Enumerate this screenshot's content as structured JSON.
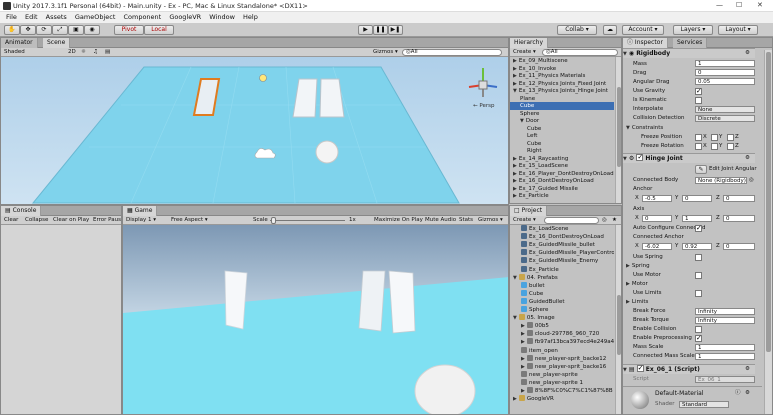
{
  "window": {
    "title": "Unity 2017.3.1f1 Personal (64bit) - Main.unity - Ex - PC, Mac & Linux Standalone* <DX11>",
    "min": "—",
    "max": "☐",
    "close": "✕"
  },
  "menu": [
    "File",
    "Edit",
    "Assets",
    "GameObject",
    "Component",
    "GoogleVR",
    "Window",
    "Help"
  ],
  "toolbar": {
    "pivot": "Pivot",
    "local": "Local",
    "collab": "Collab ▾",
    "account": "Account ▾",
    "layers": "Layers ▾",
    "layout": "Layout ▾"
  },
  "scene": {
    "tabs": [
      "Animator",
      "Scene"
    ],
    "shading": "Shaded",
    "mode2d": "2D",
    "gizmos": "Gizmos ▾",
    "search": "◎All",
    "persp": "← Persp"
  },
  "hierarchy": {
    "tab": "Hierarchy",
    "create": "Create ▾",
    "search": "◎All",
    "items": [
      {
        "label": "Ex_09_Multiscene",
        "indent": 0,
        "fold": "▶"
      },
      {
        "label": "Ex_10_Invoke",
        "indent": 0,
        "fold": "▶"
      },
      {
        "label": "Ex_11_Physics Materials",
        "indent": 0,
        "fold": "▶"
      },
      {
        "label": "Ex_12_Physics Joints_Fixed Joint",
        "indent": 0,
        "fold": "▶"
      },
      {
        "label": "Ex_13_Physics Joints_Hinge Joint",
        "indent": 0,
        "fold": "▼"
      },
      {
        "label": "Plane",
        "indent": 1,
        "fold": ""
      },
      {
        "label": "Cube",
        "indent": 1,
        "fold": "",
        "selected": true
      },
      {
        "label": "Sphere",
        "indent": 1,
        "fold": ""
      },
      {
        "label": "Door",
        "indent": 1,
        "fold": "▼"
      },
      {
        "label": "Cube",
        "indent": 2,
        "fold": ""
      },
      {
        "label": "Left",
        "indent": 2,
        "fold": ""
      },
      {
        "label": "Cube",
        "indent": 2,
        "fold": ""
      },
      {
        "label": "Right",
        "indent": 2,
        "fold": ""
      },
      {
        "label": "Ex_14_Raycasting",
        "indent": 0,
        "fold": "▶"
      },
      {
        "label": "Ex_15_LoadScene",
        "indent": 0,
        "fold": "▶"
      },
      {
        "label": "Ex_16_Player_DontDestroyOnLoad",
        "indent": 0,
        "fold": "▶"
      },
      {
        "label": "Ex_16_DontDestroyOnLoad",
        "indent": 0,
        "fold": "▶"
      },
      {
        "label": "Ex_17_Guided Missile",
        "indent": 0,
        "fold": "▶"
      },
      {
        "label": "Ex_Particle",
        "indent": 0,
        "fold": "▶"
      }
    ]
  },
  "console": {
    "tab": "Console",
    "buttons": [
      "Clear",
      "Collapse",
      "Clear on Play",
      "Error Pause"
    ]
  },
  "game": {
    "tab": "Game",
    "display": "Display 1 ▾",
    "aspect": "Free Aspect ▾",
    "scale_label": "Scale",
    "scale_value": "1x",
    "buttons": [
      "Maximize On Play",
      "Mute Audio",
      "Stats",
      "Gizmos ▾"
    ]
  },
  "project": {
    "tab": "Project",
    "create": "Create ▾",
    "items": [
      {
        "label": "Ex_LoadScene",
        "indent": 1,
        "icon": "scene"
      },
      {
        "label": "Ex_16_DontDestroyOnLoad",
        "indent": 1,
        "icon": "scene"
      },
      {
        "label": "Ex_GuidedMissile_bullet",
        "indent": 1,
        "icon": "scene"
      },
      {
        "label": "Ex_GuidedMissile_PlayerControl",
        "indent": 1,
        "icon": "scene"
      },
      {
        "label": "Ex_GuidedMissile_Enemy",
        "indent": 1,
        "icon": "scene"
      },
      {
        "label": "Ex_Particle",
        "indent": 1,
        "icon": "scene"
      },
      {
        "label": "04. Prefabs",
        "indent": 0,
        "icon": "folder",
        "fold": "▼"
      },
      {
        "label": "bullet",
        "indent": 1,
        "icon": "prefab"
      },
      {
        "label": "Cube",
        "indent": 1,
        "icon": "prefab"
      },
      {
        "label": "GuidedBullet",
        "indent": 1,
        "icon": "prefab"
      },
      {
        "label": "Sphere",
        "indent": 1,
        "icon": "prefab"
      },
      {
        "label": "05. Image",
        "indent": 0,
        "icon": "folder",
        "fold": "▼"
      },
      {
        "label": "00b5",
        "indent": 1,
        "icon": "image",
        "fold": "▶"
      },
      {
        "label": "cloud-297786_960_720",
        "indent": 1,
        "icon": "image",
        "fold": "▶"
      },
      {
        "label": "fb97af13bca397ecd4e249a4a",
        "indent": 1,
        "icon": "image",
        "fold": "▶"
      },
      {
        "label": "item_open",
        "indent": 1,
        "icon": "image"
      },
      {
        "label": "new_player-sprit_backe12",
        "indent": 1,
        "icon": "image",
        "fold": "▶"
      },
      {
        "label": "new_player-sprit_backe16",
        "indent": 1,
        "icon": "image",
        "fold": "▶"
      },
      {
        "label": "new_player-sprite",
        "indent": 1,
        "icon": "image"
      },
      {
        "label": "new_player-sprite 1",
        "indent": 1,
        "icon": "image"
      },
      {
        "label": "8%8F%C0%C7%C1%87%8B",
        "indent": 1,
        "icon": "image",
        "fold": "▶"
      },
      {
        "label": "GoogleVR",
        "indent": 0,
        "icon": "folder",
        "fold": "▶"
      }
    ]
  },
  "inspector": {
    "tabs": [
      "Inspector",
      "Services"
    ],
    "rigidbody": {
      "title": "Rigidbody",
      "rows": [
        {
          "label": "Mass",
          "value": "1"
        },
        {
          "label": "Drag",
          "value": "0"
        },
        {
          "label": "Angular Drag",
          "value": "0.05"
        }
      ],
      "use_gravity": "Use Gravity",
      "is_kinematic": "Is Kinematic",
      "interpolate": {
        "label": "Interpolate",
        "value": "None"
      },
      "collision": {
        "label": "Collision Detection",
        "value": "Discrete"
      },
      "constraints": "Constraints",
      "freeze_pos": "Freeze Position",
      "freeze_rot": "Freeze Rotation",
      "xyz": [
        "X",
        "Y",
        "Z"
      ]
    },
    "hinge": {
      "title": "Hinge Joint",
      "edit_label": "Edit Joint Angular Limits",
      "connected_body": {
        "label": "Connected Body",
        "value": "None (Rigidbody)"
      },
      "anchor": {
        "label": "Anchor",
        "x": "-0.5",
        "y": "0",
        "z": "0"
      },
      "axis": {
        "label": "Axis",
        "x": "0",
        "y": "1",
        "z": "0"
      },
      "auto_config": "Auto Configure Connected",
      "connected_anchor": {
        "label": "Connected Anchor",
        "x": "-6.02",
        "y": "0.92",
        "z": "0"
      },
      "use_spring": "Use Spring",
      "spring": "Spring",
      "use_motor": "Use Motor",
      "motor": "Motor",
      "use_limits": "Use Limits",
      "limits": "Limits",
      "break_force": {
        "label": "Break Force",
        "value": "Infinity"
      },
      "break_torque": {
        "label": "Break Torque",
        "value": "Infinity"
      },
      "enable_collision": "Enable Collision",
      "enable_preprocessing": "Enable Preprocessing",
      "mass_scale": {
        "label": "Mass Scale",
        "value": "1"
      },
      "connected_mass_scale": {
        "label": "Connected Mass Scale",
        "value": "1"
      }
    },
    "script": {
      "title": "Ex_06_1 (Script)",
      "label": "Script",
      "value": "Ex_06_1"
    },
    "material": {
      "title": "Default-Material",
      "shader_label": "Shader",
      "shader_value": "Standard"
    }
  },
  "colors": {
    "scene_floor": "#7fd3ec",
    "sky": "#bcd9ef",
    "door_selected": "#e07b1f",
    "selection": "#3d6fb3"
  }
}
